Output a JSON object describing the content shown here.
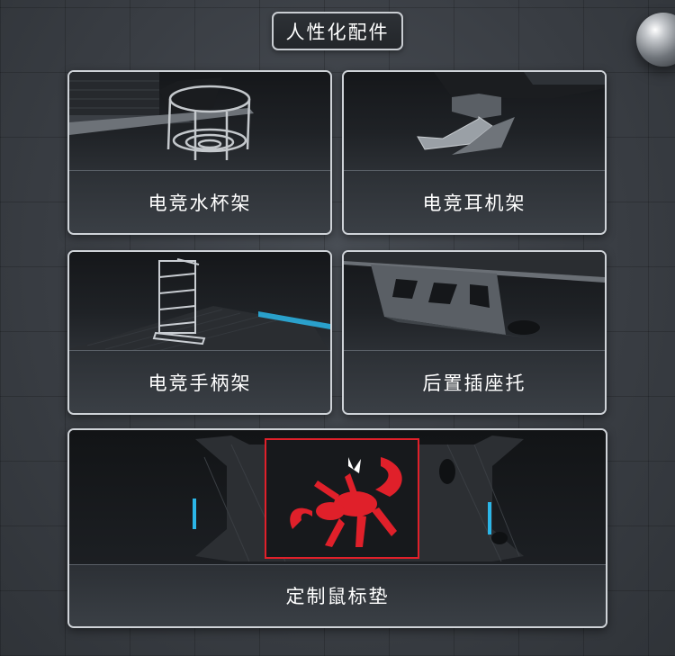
{
  "header": {
    "title": "人性化配件"
  },
  "cards": [
    {
      "label": "电竞水杯架"
    },
    {
      "label": "电竞耳机架"
    },
    {
      "label": "电竞手柄架"
    },
    {
      "label": "后置插座托"
    },
    {
      "label": "定制鼠标垫"
    }
  ],
  "colors": {
    "accent_red": "#e0202a",
    "accent_cyan": "#2bb6e8",
    "border": "#cfd3d8"
  }
}
